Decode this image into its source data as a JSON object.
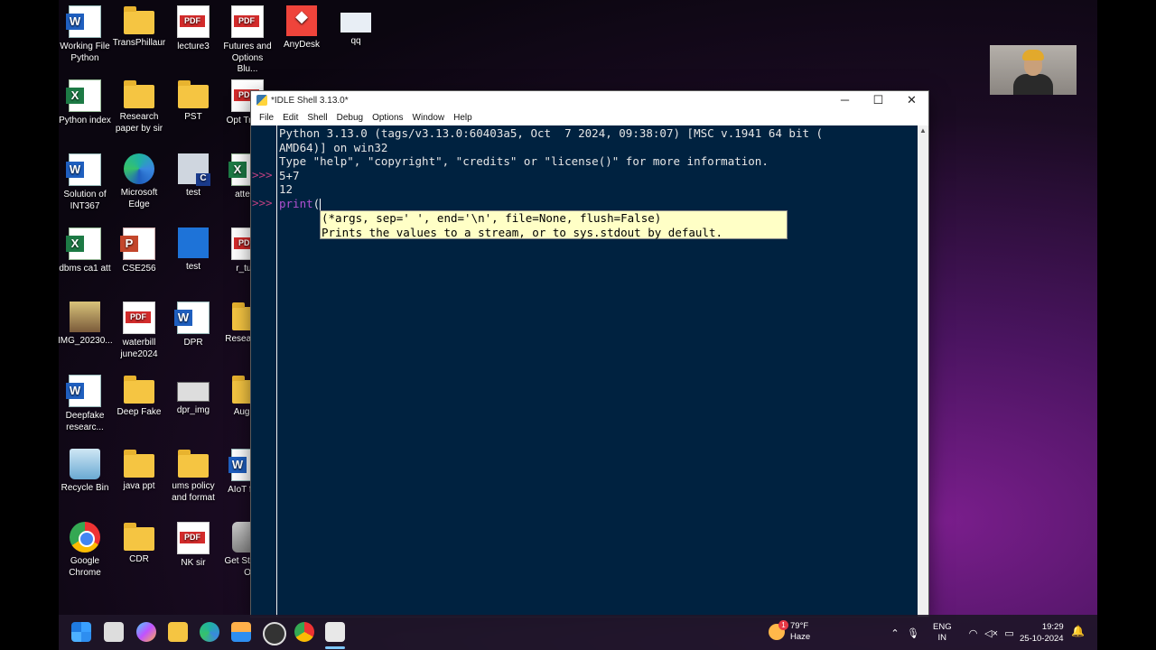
{
  "desktop": {
    "icons": [
      {
        "label": "Working File Python",
        "icon": "word-doc-icon"
      },
      {
        "label": "TransPhillaur",
        "icon": "folder-icon"
      },
      {
        "label": "lecture3",
        "icon": "pdf-icon"
      },
      {
        "label": "Futures and Options Blu...",
        "icon": "pdf-icon"
      },
      {
        "label": "AnyDesk",
        "icon": "anydesk-icon"
      },
      {
        "label": "qq",
        "icon": "file-icon"
      },
      {
        "label": "Python index",
        "icon": "excel-icon"
      },
      {
        "label": "Research paper by sir",
        "icon": "folder-icon"
      },
      {
        "label": "PST",
        "icon": "folder-icon"
      },
      {
        "label": "Solution of INT367",
        "icon": "word-doc-icon"
      },
      {
        "label": "Microsoft Edge",
        "icon": "edge-icon"
      },
      {
        "label": "test",
        "icon": "c-file-icon"
      },
      {
        "label": "dbms ca1 att",
        "icon": "excel-icon"
      },
      {
        "label": "CSE256",
        "icon": "powerpoint-icon"
      },
      {
        "label": "test",
        "icon": "document-icon"
      },
      {
        "label": "IMG_20230...",
        "icon": "photo-icon"
      },
      {
        "label": "waterbill june2024",
        "icon": "pdf-icon"
      },
      {
        "label": "DPR",
        "icon": "word-doc-icon"
      },
      {
        "label": "Deepfake researc...",
        "icon": "word-doc-icon"
      },
      {
        "label": "Deep Fake",
        "icon": "folder-icon"
      },
      {
        "label": "dpr_img",
        "icon": "image-icon"
      },
      {
        "label": "Recycle Bin",
        "icon": "recycle-bin-icon"
      },
      {
        "label": "java ppt",
        "icon": "folder-icon"
      },
      {
        "label": "ums policy and format",
        "icon": "folder-icon"
      },
      {
        "label": "Google Chrome",
        "icon": "chrome-icon"
      },
      {
        "label": "CDR",
        "icon": "folder-icon"
      },
      {
        "label": "NK sir",
        "icon": "pdf-icon"
      }
    ],
    "partial_icons": [
      "Opt Tradin",
      "attend",
      "r_tuto",
      "Resea Pap",
      "AugDe",
      "AIoT form",
      "Get St With O"
    ]
  },
  "idle": {
    "title": "*IDLE Shell 3.13.0*",
    "menu": [
      "File",
      "Edit",
      "Shell",
      "Debug",
      "Options",
      "Window",
      "Help"
    ],
    "window_buttons": {
      "minimize": "─",
      "maximize": "☐",
      "close": "✕"
    },
    "prompt": ">>>",
    "lines": {
      "banner1": "Python 3.13.0 (tags/v3.13.0:60403a5, Oct  7 2024, 09:38:07) [MSC v.1941 64 bit (",
      "banner2": "AMD64)] on win32",
      "banner3": "Type \"help\", \"copyright\", \"credits\" or \"license()\" for more information.",
      "input1": "5+7",
      "output1": "12",
      "input2_kw": "print",
      "input2_paren": "("
    },
    "calltip": {
      "line1": "(*args, sep=' ', end='\\n', file=None, flush=False)",
      "line2": "Prints the values to a stream, or to sys.stdout by default."
    }
  },
  "taskbar": {
    "apps": [
      "start-icon",
      "task-view-icon",
      "copilot-icon",
      "file-explorer-icon",
      "edge-icon",
      "store-icon",
      "chatgpt-icon",
      "chrome-icon",
      "idle-icon"
    ],
    "weather_temp": "79°F",
    "weather_desc": "Haze",
    "weather_badge": "1",
    "lang_top": "ENG",
    "lang_bottom": "IN",
    "time": "19:29",
    "date": "25-10-2024"
  }
}
